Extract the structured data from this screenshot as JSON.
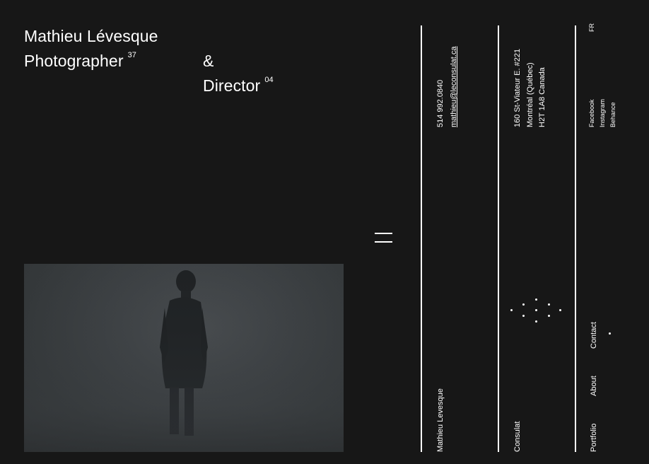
{
  "header": {
    "name": "Mathieu Lévesque",
    "role1": "Photographer",
    "role1_count": "37",
    "ampersand": "&",
    "role2": "Director",
    "role2_count": "04"
  },
  "contact": {
    "phone": "514 992.0840",
    "email": "mathieu@leconsulat.ca",
    "owner_name": "Mathieu Levesque"
  },
  "agency": {
    "address_line1": "160 St-Viateur E. #221",
    "address_line2": "Montréal (Québec)",
    "address_line3": "H2T 1A8 Canada",
    "name": "Consulat"
  },
  "nav": {
    "language": "FR",
    "social": [
      "Facebook",
      "Instagram",
      "Behance"
    ],
    "items": [
      "Contact",
      "About",
      "Portfolio"
    ]
  },
  "colors": {
    "background": "#171717",
    "foreground": "#ffffff"
  }
}
